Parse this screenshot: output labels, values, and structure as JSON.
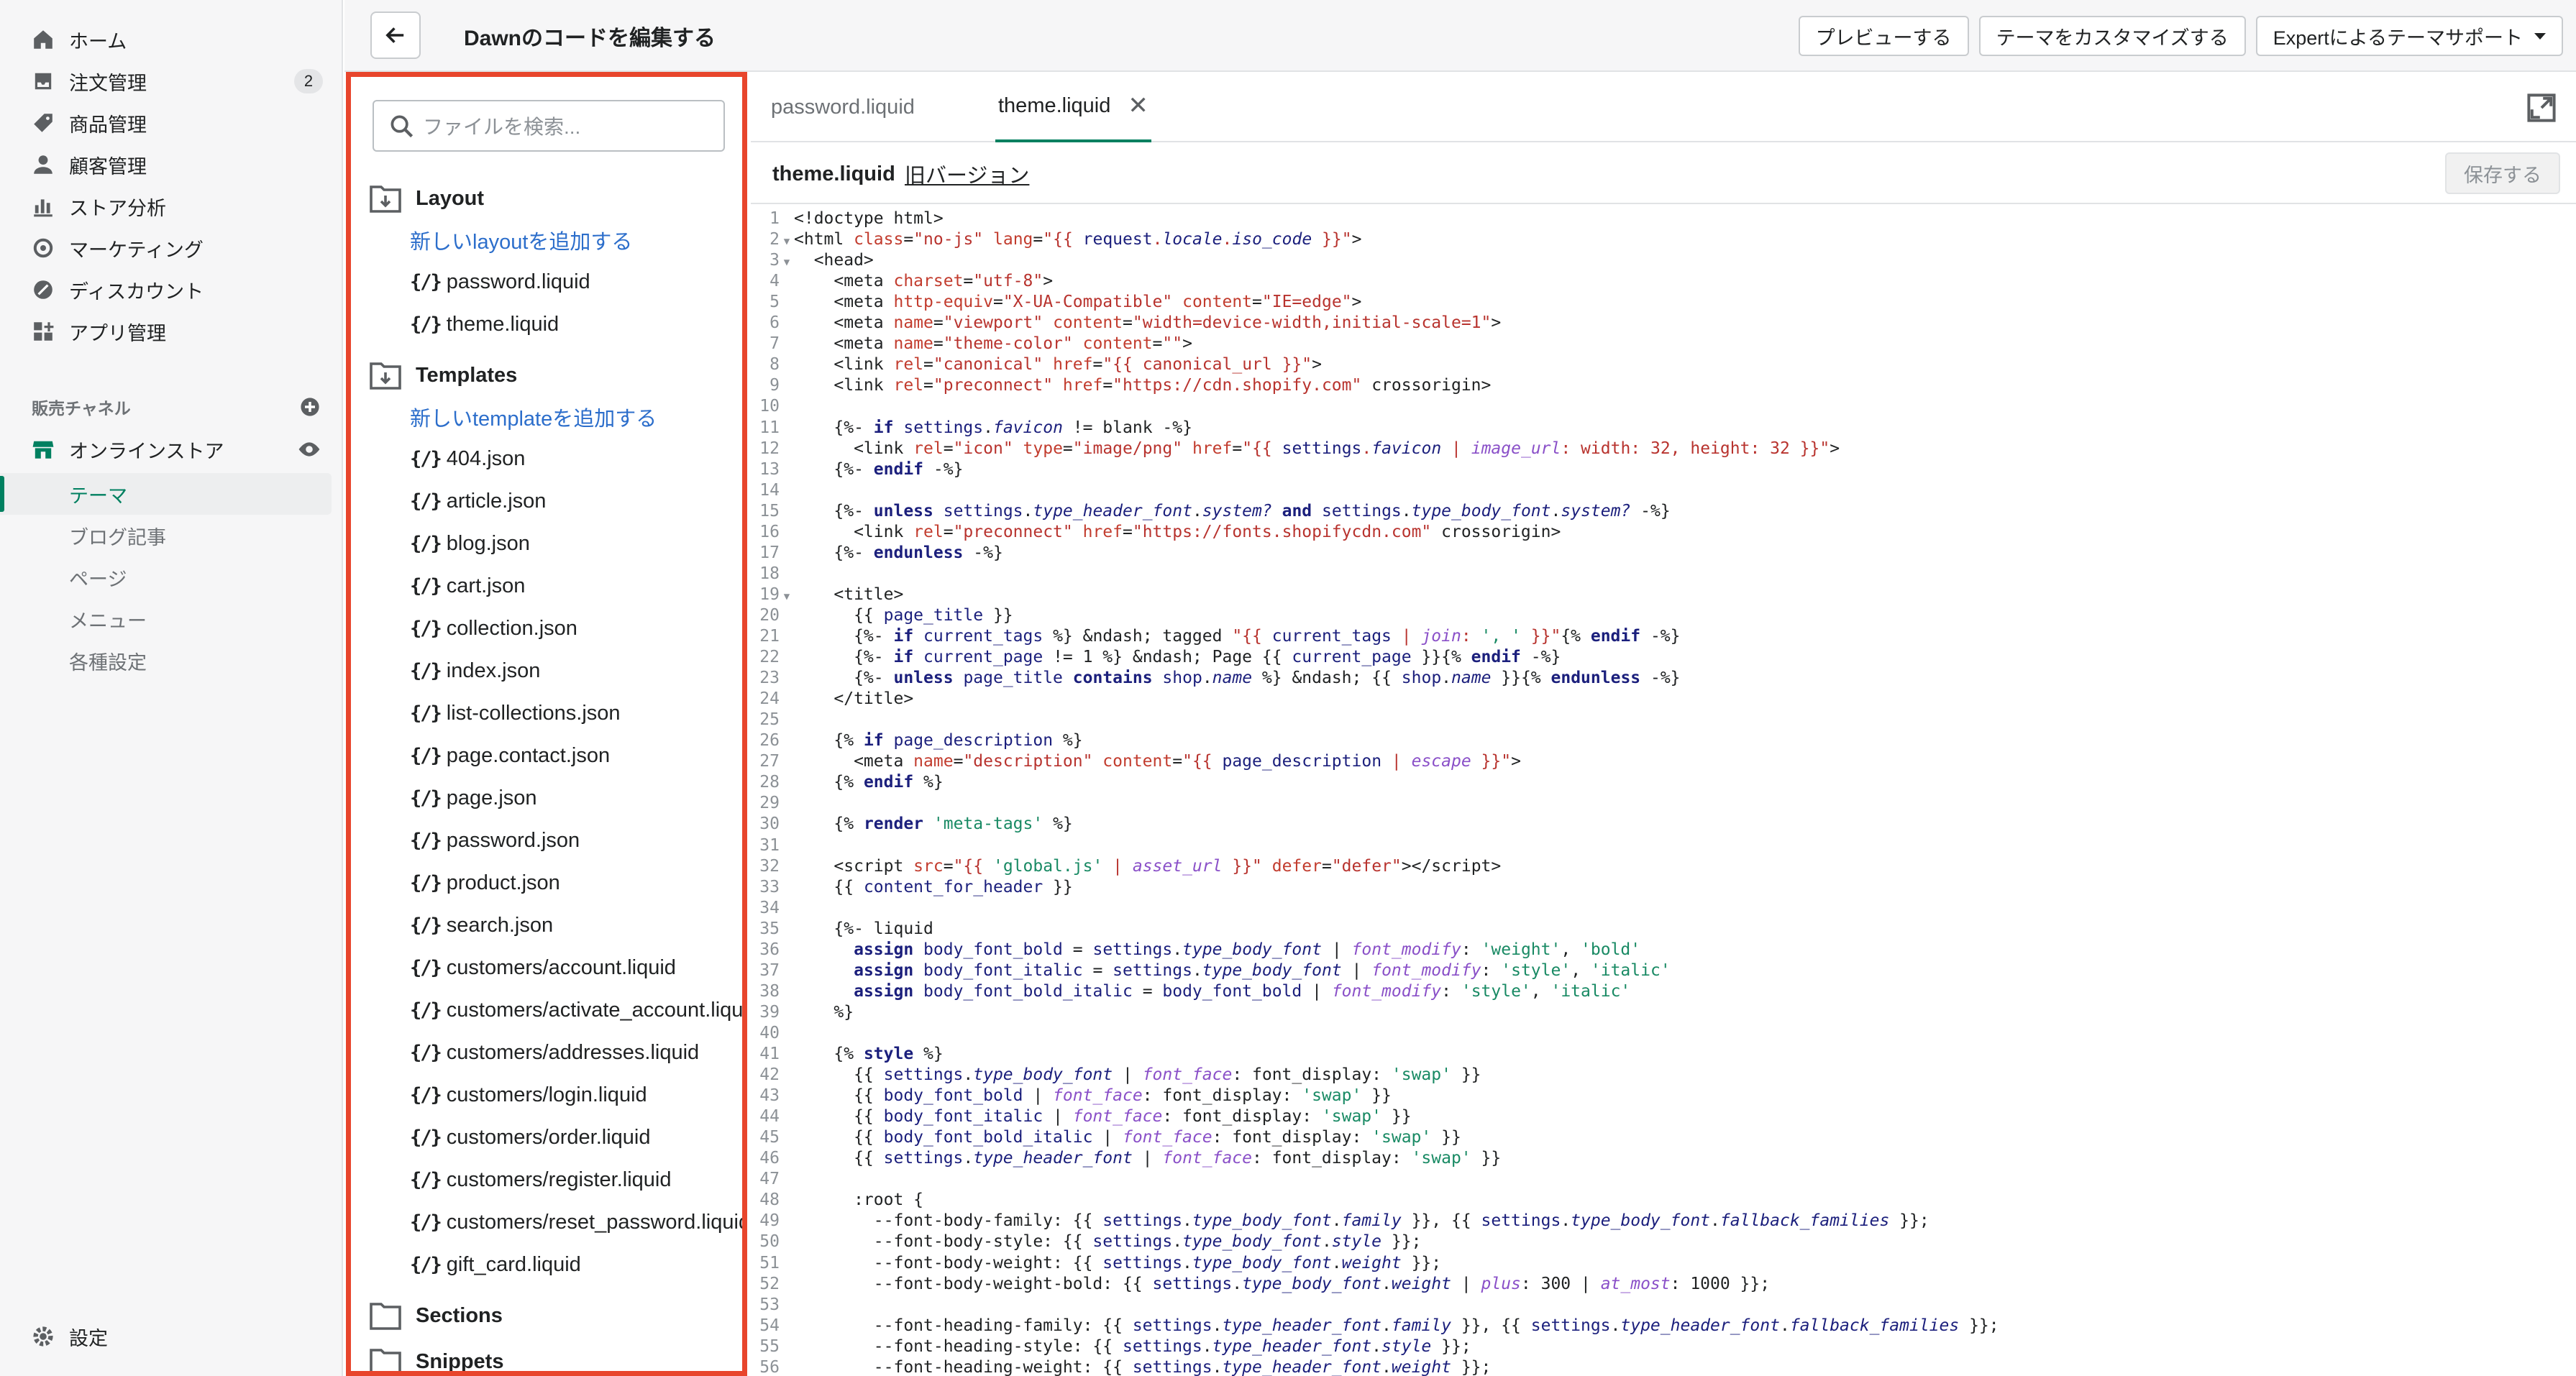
{
  "sidebar": {
    "nav": [
      {
        "label": "ホーム",
        "icon": "home-icon"
      },
      {
        "label": "注文管理",
        "icon": "orders-icon",
        "badge": "2"
      },
      {
        "label": "商品管理",
        "icon": "tag-icon"
      },
      {
        "label": "顧客管理",
        "icon": "customer-icon"
      },
      {
        "label": "ストア分析",
        "icon": "analytics-icon"
      },
      {
        "label": "マーケティング",
        "icon": "marketing-icon"
      },
      {
        "label": "ディスカウント",
        "icon": "discount-icon"
      },
      {
        "label": "アプリ管理",
        "icon": "apps-icon"
      }
    ],
    "channels_label": "販売チャネル",
    "online_store": "オンラインストア",
    "sub": [
      "テーマ",
      "ブログ記事",
      "ページ",
      "メニュー",
      "各種設定"
    ],
    "settings": "設定"
  },
  "topbar": {
    "title": "Dawnのコードを編集する",
    "preview": "プレビューする",
    "customize": "テーマをカスタマイズする",
    "expert": "Expertによるテーマサポート"
  },
  "files": {
    "search_placeholder": "ファイルを検索...",
    "layout": {
      "title": "Layout",
      "add": "新しいlayoutを追加する",
      "items": [
        "password.liquid",
        "theme.liquid"
      ]
    },
    "templates": {
      "title": "Templates",
      "add": "新しいtemplateを追加する",
      "items": [
        "404.json",
        "article.json",
        "blog.json",
        "cart.json",
        "collection.json",
        "index.json",
        "list-collections.json",
        "page.contact.json",
        "page.json",
        "password.json",
        "product.json",
        "search.json",
        "customers/account.liquid",
        "customers/activate_account.liquid",
        "customers/addresses.liquid",
        "customers/login.liquid",
        "customers/order.liquid",
        "customers/register.liquid",
        "customers/reset_password.liquid",
        "gift_card.liquid"
      ]
    },
    "sections_title": "Sections",
    "snippets_title": "Snippets"
  },
  "editor": {
    "tabs": [
      "password.liquid",
      "theme.liquid"
    ],
    "file_name": "theme.liquid",
    "old_version": "旧バージョン",
    "save": "保存する"
  },
  "colors": {
    "accent": "#008060",
    "highlight": "#e8452c",
    "link": "#2c6ecb"
  }
}
